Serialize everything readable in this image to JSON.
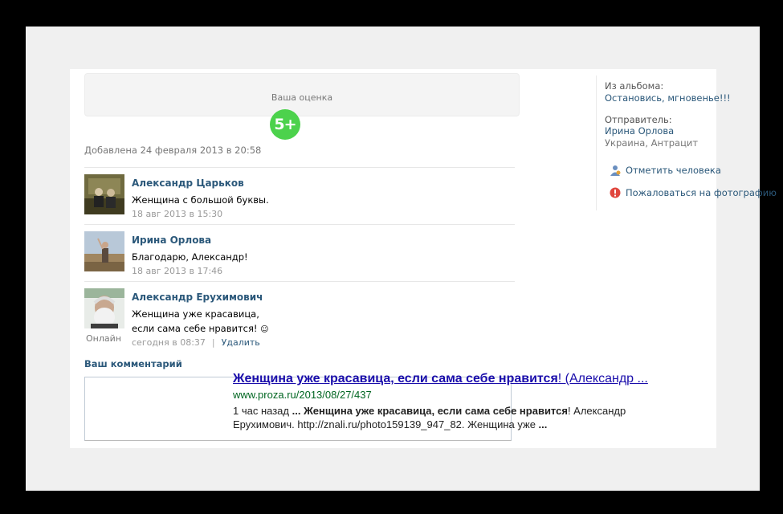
{
  "rating": {
    "label": "Ваша оценка",
    "badge": "5+"
  },
  "photo": {
    "added": "Добавлена 24 февраля 2013 в 20:58"
  },
  "comments": [
    {
      "name": "Александр Царьков",
      "text": [
        "Женщина с большой буквы."
      ],
      "date": "18 авг 2013 в 15:30"
    },
    {
      "name": "Ирина Орлова",
      "text": [
        "Благодарю, Александр!"
      ],
      "date": "18 авг 2013 в 17:46"
    },
    {
      "name": "Александр Ерухимович",
      "text": [
        "Женщина уже красавица,",
        "если сама себе нравится!"
      ],
      "date": "сегодня в 08:37",
      "status": "Онлайн",
      "delete_label": "Удалить",
      "separator": "|"
    }
  ],
  "comment_form": {
    "label": "Ваш комментарий"
  },
  "search_result": {
    "title_bold": "Женщина уже красавица, если сама себе нравится",
    "title_rest": "! (Александр ...",
    "url": "www.proza.ru/2013/08/27/437",
    "snippet_time": "1 час назад",
    "snippet_dots1": " ... ",
    "snippet_bold": "Женщина уже красавица, если сама себе нравится",
    "snippet_mid": "! Александр Ерухимович. http://znali.ru/photo159139_947_82. Женщина уже",
    "snippet_dots2": " ..."
  },
  "sidebar": {
    "album_label": "Из альбома:",
    "album_name": "Остановись, мгновенье!!!",
    "sender_label": "Отправитель:",
    "sender_name": "Ирина Орлова",
    "sender_location": "Украина, Антрацит",
    "tag_person": "Отметить человека",
    "report_photo": "Пожаловаться на фотографию"
  },
  "colors": {
    "link": "#2b587a",
    "badge": "#4cd24c",
    "search_link": "#1a0dab",
    "search_url": "#006621"
  }
}
